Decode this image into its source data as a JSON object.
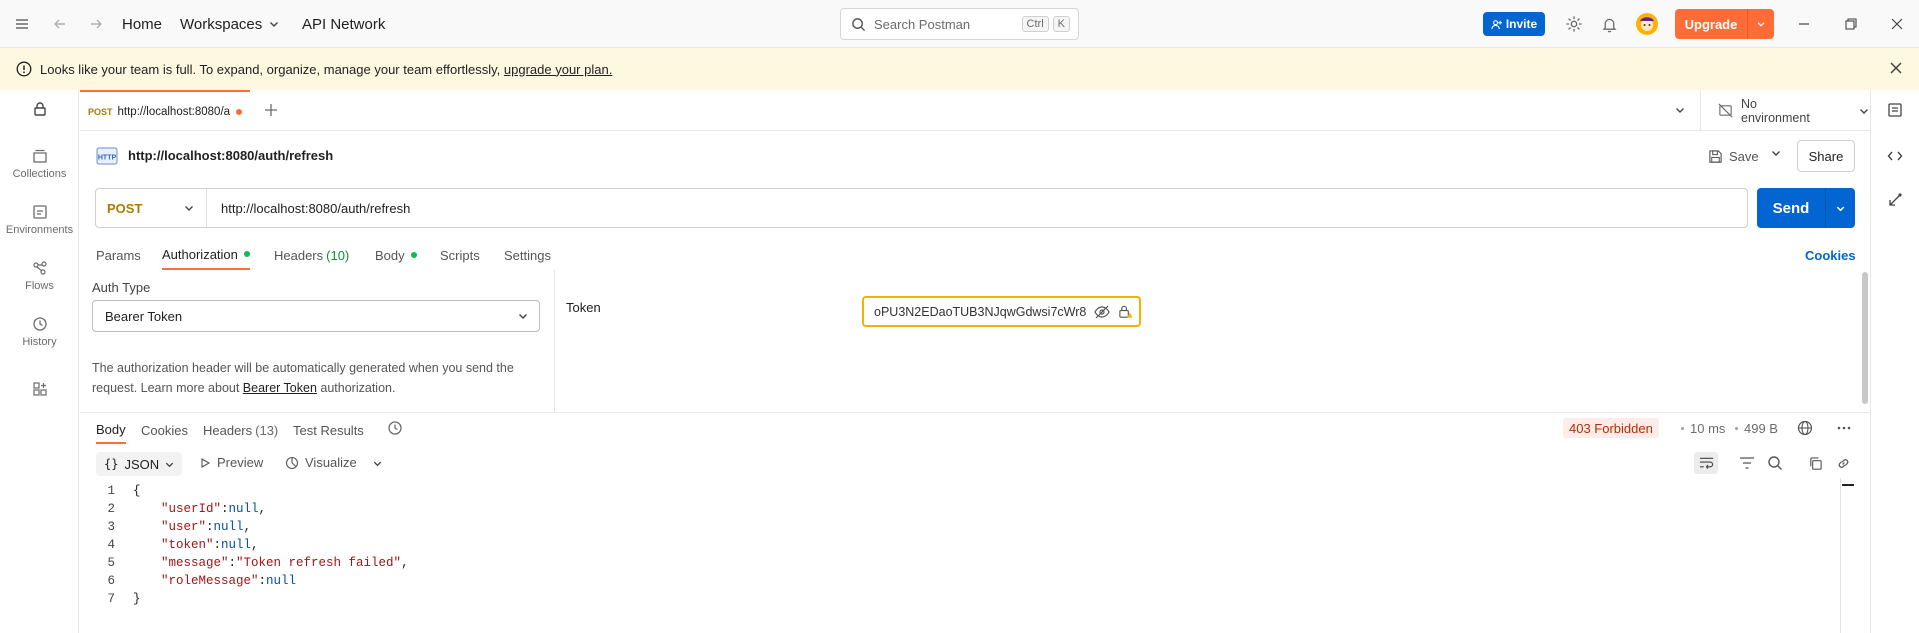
{
  "topbar": {
    "home": "Home",
    "workspaces": "Workspaces",
    "api_network": "API Network",
    "search_placeholder": "Search Postman",
    "kbd_ctrl": "Ctrl",
    "kbd_k": "K",
    "invite": "Invite",
    "upgrade": "Upgrade"
  },
  "banner": {
    "text": "Looks like your team is full. To expand, organize, manage your team effortlessly, ",
    "link": "upgrade your plan."
  },
  "sidebar": {
    "items": [
      {
        "label": "Collections",
        "icon": "collections-icon"
      },
      {
        "label": "Environments",
        "icon": "environments-icon"
      },
      {
        "label": "Flows",
        "icon": "flows-icon"
      },
      {
        "label": "History",
        "icon": "history-icon"
      }
    ]
  },
  "tabs": {
    "active_method": "POST",
    "active_title": "http://localhost:8080/a",
    "environment": "No environment"
  },
  "request": {
    "title": "http://localhost:8080/auth/refresh",
    "save": "Save",
    "share": "Share",
    "method": "POST",
    "url": "http://localhost:8080/auth/refresh",
    "send": "Send"
  },
  "request_tabs": {
    "params": "Params",
    "authorization": "Authorization",
    "headers": "Headers",
    "headers_count": "(10)",
    "body": "Body",
    "scripts": "Scripts",
    "settings": "Settings",
    "cookies": "Cookies"
  },
  "auth": {
    "type_label": "Auth Type",
    "type_value": "Bearer Token",
    "desc_1": "The authorization header will be automatically generated when you send the",
    "desc_2_pre": "request. Learn more about ",
    "desc_link": "Bearer Token",
    "desc_2_post": " authorization.",
    "token_label": "Token",
    "token_value": "oPU3N2EDaoTUB3NJqwGdwsi7cWr8"
  },
  "response": {
    "tabs": {
      "body": "Body",
      "cookies": "Cookies",
      "headers": "Headers",
      "headers_count": "(13)",
      "test_results": "Test Results"
    },
    "status": "403 Forbidden",
    "time": "10 ms",
    "size": "499 B",
    "format": "JSON",
    "preview": "Preview",
    "visualize": "Visualize",
    "lines": [
      {
        "n": "1",
        "indent": false,
        "key": "",
        "value": "{",
        "vtype": "punc",
        "comma": false
      },
      {
        "n": "2",
        "indent": true,
        "key": "\"userId\"",
        "value": "null",
        "vtype": "null",
        "comma": true
      },
      {
        "n": "3",
        "indent": true,
        "key": "\"user\"",
        "value": "null",
        "vtype": "null",
        "comma": true
      },
      {
        "n": "4",
        "indent": true,
        "key": "\"token\"",
        "value": "null",
        "vtype": "null",
        "comma": true
      },
      {
        "n": "5",
        "indent": true,
        "key": "\"message\"",
        "value": "\"Token refresh failed\"",
        "vtype": "str",
        "comma": true
      },
      {
        "n": "6",
        "indent": true,
        "key": "\"roleMessage\"",
        "value": "null",
        "vtype": "null",
        "comma": false
      },
      {
        "n": "7",
        "indent": false,
        "key": "",
        "value": "}",
        "vtype": "punc",
        "comma": false
      }
    ]
  },
  "colors": {
    "accent": "#ff6c37",
    "primary": "#0265d2",
    "banner_bg": "#fff8e1",
    "status_bg": "#ffebe7"
  }
}
